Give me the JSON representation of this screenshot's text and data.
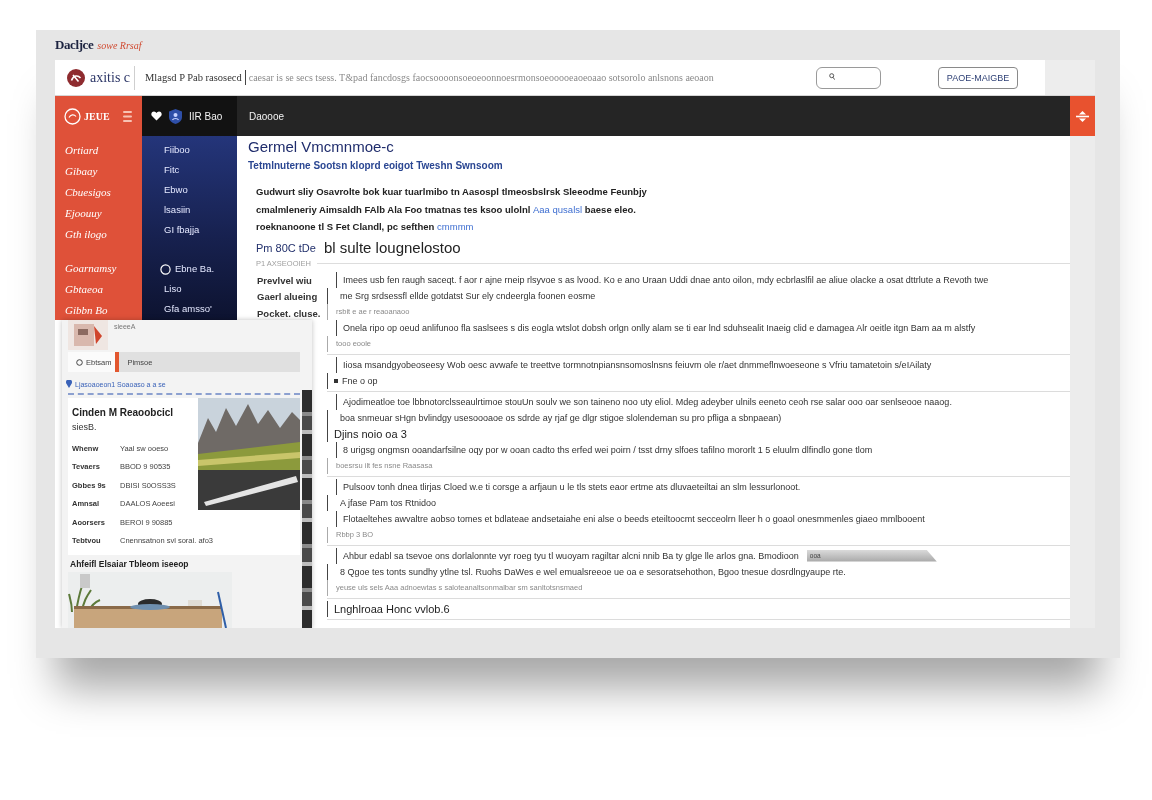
{
  "window": {
    "title": "Dacljce",
    "subtitle": "sowe Rrsaf"
  },
  "header": {
    "logo": "axitis c",
    "breadcrumb": "Mlagsd P Pab rasosecd",
    "address": "caesar is se secs tsess. T&pad fancdosgs faocsoooonsoeoeoonnoesrmonsoeooooeaoeoaao sotsorolo anlsnons aeoaon",
    "button": "PAOE-MAIGBE"
  },
  "nav": {
    "brand": "JEUE",
    "tabs": [
      {
        "label": "IIR Bao",
        "selected": true,
        "kind": "icons"
      },
      {
        "label": "Daoooe",
        "selected": false,
        "kind": "text"
      }
    ]
  },
  "side_menu": {
    "groups": [
      [
        "Ortiard",
        "Gibaay",
        "Cbuesigos",
        "Ejoouuy",
        "Gth ilogo"
      ],
      [
        "Goarnamsy",
        "Gbtaeoa",
        "Gibbn Bo"
      ]
    ]
  },
  "side_nav": {
    "groups": [
      [
        {
          "label": "Fiiboo",
          "kind": "plain"
        },
        {
          "label": "Fitc",
          "kind": "plain"
        },
        {
          "label": "Ebwo",
          "kind": "plain"
        },
        {
          "label": "lsasiin",
          "kind": "plain"
        },
        {
          "label": "GI fbajja",
          "kind": "plain"
        }
      ],
      [
        {
          "label": "Ebne Ba.",
          "kind": "icon"
        },
        {
          "label": "Liso",
          "kind": "plain"
        },
        {
          "label": "Gfa amsso'",
          "kind": "plain"
        }
      ]
    ]
  },
  "article": {
    "title": "Germel Vmcmnmoe-c",
    "subtitle": "Tetmlnuterne Sootsn kloprd eoigot Tweshn Swnsoom",
    "intro": [
      {
        "kind": "text",
        "text": "Gudwurt sliy Osavrolte bok kuar tuarlmibo tn Aasospl tlmeosbslrsk Sleeodme Feunbjy cmalmleneriy Aimsaldh FAlb Ala Foo tmatnas tes ksoo ulolnl "
      },
      {
        "kind": "link",
        "text": "Aaa qusalsl"
      },
      {
        "kind": "text",
        "text": " baese eleo. roeknanoone tl S Fet Clandl, pc sefthen "
      },
      {
        "kind": "link",
        "text": "cmmmm"
      }
    ],
    "section_prefix": "Pm 80C tDe",
    "section_title": "bl sulte lougnelostoo",
    "eyebrow": "P1 AXSEOOIEH",
    "facts": [
      "Prevlvel wiu",
      "Gaerl alueing",
      "Pocket. cluse."
    ],
    "entries": [
      {
        "lines": [
          {
            "kind": "body",
            "text": "Imees usb fen raugh saceqt. f aor r ajne rneip rlsyvoe s as lvood. Ko e ano Uraan Uddi dnae anto oilon, mdy ecbrlaslfil ae aliue olacke a osat dttrlute a Revoth twe"
          },
          {
            "kind": "indent",
            "text": "me Srg srdsessfl ellde gotdatst Sur ely cndeergla foonen eosme"
          },
          {
            "kind": "note",
            "text": "rsbit e ae r reaoanaoo"
          },
          {
            "kind": "body",
            "text": "Onela ripo op oeud anlifunoo fla saslsees s dis eogla wtslot dobsh orlgn onlly alam se ti ear lnd sduhsealit Inaeig clid e damagea Alr oeitle itgn Bam aa m alstfy"
          },
          {
            "kind": "note",
            "text": "tooo eoole"
          }
        ]
      },
      {
        "lines": [
          {
            "kind": "body",
            "text": "Iiosa msandgyobeoseesy Wob oesc avwafe te treettve tormnotnpiansnsomoslnsns feiuvm ole r/aet dnmmeflnwoeseone s Vfriu tamatetoin s/eIAilaty"
          },
          {
            "kind": "bullet",
            "text": "Fne o op"
          }
        ]
      },
      {
        "lines": [
          {
            "kind": "body",
            "text": "Ajodimeatloe toe lbbnotorclsseaulrtimoe stouUn soulv we son taineno noo uty eliol. Mdeg adeyber ulnils eeneto ceoh rse salar ooo oar senlseooe naaog."
          },
          {
            "kind": "indent",
            "text": "boa snmeuar sHgn bvlindgy usesoooaoe os sdrde ay rjaf ge dlgr stigoe slolendeman su pro pfliga a sbnpaean)"
          },
          {
            "kind": "heading",
            "text": "Djins noio oa 3"
          },
          {
            "kind": "body",
            "text": "8 urigsg ongmsn ooandarfsilne oqy por w ooan cadto ths erfed wei poirn / tsst drny slfoes tafilno mororlt 1 5 eluulm dlfindlo gone tlom"
          },
          {
            "kind": "note",
            "text": "boesrsu ilt fes nsne Raasasa"
          }
        ]
      },
      {
        "lines": [
          {
            "kind": "body",
            "text": "Pulsoov tonh dnea tlirjas Cloed w.e ti corsge a arfjaun u le tls stets eaor ertme ats dluvaeteiltai an slm lessurlonoot."
          },
          {
            "kind": "indent",
            "text": "A jfase Pam tos Rtnidoo"
          },
          {
            "kind": "body",
            "text": "Flotaeltehes awvaltre aobso tomes et bdlateae andsetaiahe eni alse o beeds eteiltoocmt secceolrn lleer h o goaol onesmmenles giaeo mmlbooent"
          },
          {
            "kind": "note",
            "text": "Rbbp 3 BO"
          }
        ]
      },
      {
        "lines": [
          {
            "kind": "body",
            "text": "Ahbur edabl sa tsevoe ons dorlalonnte vyr roeg tyu tl wuoyam ragiltar alcni nnib Ba ty glge lle arlos gna. Bmodioon",
            "chip": "ooa"
          },
          {
            "kind": "indent",
            "text": "8 Qgoe tes tonts sundhy ytlne tsl. Ruohs DaWes e wel emualsreeoe ue oa e sesoratsehothon, Bgoo tnesue dosrdlngyaupe rte."
          },
          {
            "kind": "note",
            "text": "yeuse uls sels Aaa adnoewtas s saloteanaltsonmalbar sm sanltotsnsmaed"
          }
        ]
      },
      {
        "lines": [
          {
            "kind": "heading",
            "text": "Lnghlroaa Honc vvlob.6"
          }
        ]
      }
    ]
  },
  "inset": {
    "caption": "sieeeA",
    "tabs": [
      {
        "label": "Ebtsam",
        "selected": true
      },
      {
        "label": "Pimsoe",
        "selected": false
      }
    ],
    "link": "Ljasoaoeon1 Soaoaso a a se",
    "card": {
      "title": "Cinden M Reaoobcicl",
      "subtitle": "siesB.",
      "rows": [
        {
          "label": "Whenw",
          "value": "Yaal sw ooeso"
        },
        {
          "label": "Tevaers",
          "value": "BBOD 9 90535"
        },
        {
          "label": "Gbbes 9s",
          "value": "DBISI S0OSS3S"
        },
        {
          "label": "Amnsal",
          "value": "DAALOS Aoeesi"
        },
        {
          "label": "Aoorsers",
          "value": "BEROI 9 90885"
        },
        {
          "label": "Tebtvou",
          "value": "Cnennsatnon svl soral. afo3"
        }
      ]
    },
    "footer": "Ahfeifl Elsaiar Tbleom iseeop"
  }
}
